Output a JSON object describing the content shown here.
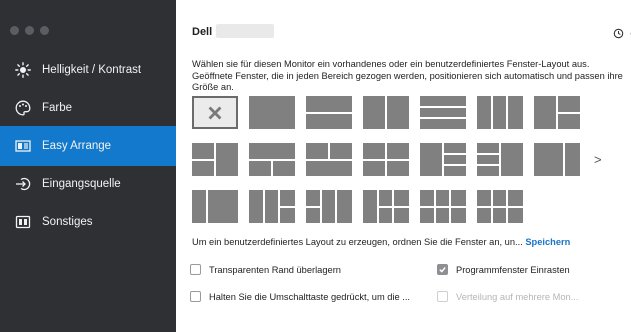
{
  "sidebar": {
    "items": [
      {
        "label": "Helligkeit / Kontrast",
        "icon": "brightness-icon"
      },
      {
        "label": "Farbe",
        "icon": "palette-icon"
      },
      {
        "label": "Easy Arrange",
        "icon": "layout-icon",
        "active": true
      },
      {
        "label": "Eingangsquelle",
        "icon": "input-source-icon"
      },
      {
        "label": "Sonstiges",
        "icon": "info-icon"
      }
    ]
  },
  "header": {
    "brand": "Dell"
  },
  "main": {
    "description": "Wählen sie für diesen Monitor ein vorhandenes oder ein benutzerdefiniertes Fenster-Layout aus.  Geöffnete Fenster, die in jeden Bereich gezogen werden, positionieren sich automatisch und passen ihre Größe an.",
    "more_label": ">",
    "hint_text": "Um ein benutzerdefiniertes Layout zu erzeugen, ordnen Sie die Fenster an, un... ",
    "hint_link": "Speichern",
    "options": [
      {
        "label": "Transparenten Rand überlagern",
        "checked": false,
        "disabled": false
      },
      {
        "label": "Programmfenster Einrasten",
        "checked": true,
        "disabled": false
      },
      {
        "label": "Halten Sie die Umschalttaste gedrückt, um die ...",
        "checked": false,
        "disabled": false
      },
      {
        "label": "Verteilung auf mehrere Mon...",
        "checked": false,
        "disabled": true
      }
    ]
  },
  "colors": {
    "sidebar_bg": "#2e3034",
    "active_bg": "#1279cc",
    "tile": "#808080",
    "link": "#1a73c9"
  }
}
